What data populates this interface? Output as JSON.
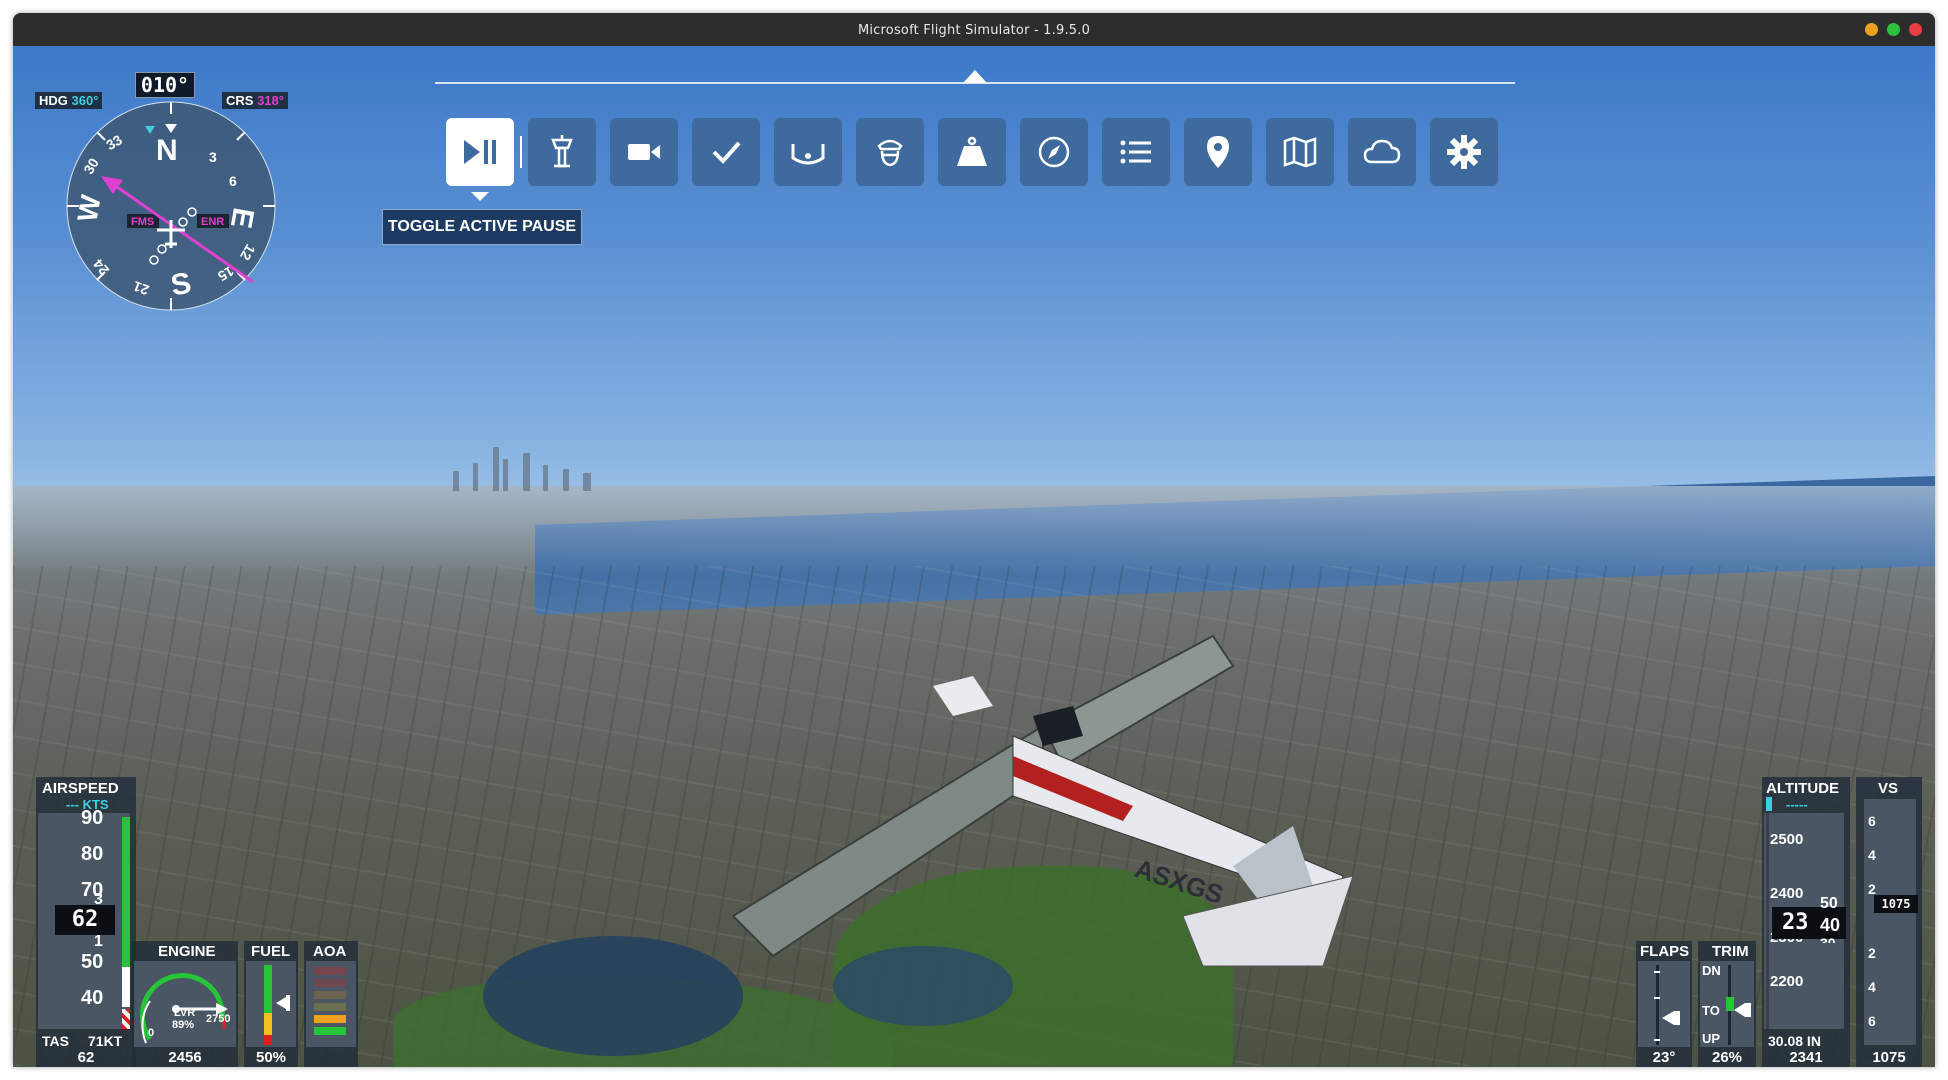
{
  "window": {
    "title": "Microsoft Flight Simulator - 1.9.5.0",
    "controls": {
      "minimize_color": "#f0a020",
      "zoom_color": "#30c040",
      "close_color": "#e84040"
    }
  },
  "toolbar": {
    "buttons": [
      {
        "name": "pause",
        "icon": "play-pause-icon",
        "active": true
      },
      {
        "name": "atc",
        "icon": "control-tower-icon"
      },
      {
        "name": "camera",
        "icon": "video-camera-icon"
      },
      {
        "name": "checklist",
        "icon": "checkmark-icon"
      },
      {
        "name": "controls",
        "icon": "yoke-icon"
      },
      {
        "name": "pilot",
        "icon": "pilot-icon"
      },
      {
        "name": "weight",
        "icon": "weight-icon"
      },
      {
        "name": "navlog",
        "icon": "compass-icon"
      },
      {
        "name": "objectives",
        "icon": "list-icon"
      },
      {
        "name": "waypoints",
        "icon": "map-pin-icon"
      },
      {
        "name": "vfr-map",
        "icon": "map-icon"
      },
      {
        "name": "weather",
        "icon": "cloud-icon"
      },
      {
        "name": "settings",
        "icon": "gear-icon"
      }
    ],
    "tooltip": "TOGGLE ACTIVE PAUSE"
  },
  "compass": {
    "hdg_label": "HDG",
    "hdg_value": "360°",
    "crs_label": "CRS",
    "crs_value": "318°",
    "heading_readout": "010°",
    "cardinals": {
      "n": "N",
      "e": "E",
      "s": "S",
      "w": "W"
    },
    "numbers": [
      "3",
      "6",
      "12",
      "15",
      "21",
      "24",
      "30",
      "33"
    ],
    "fms": "FMS",
    "enr": "ENR"
  },
  "airspeed": {
    "label": "AIRSPEED",
    "unit": "--- KTS",
    "ticks": [
      "90",
      "80",
      "70",
      "50",
      "40"
    ],
    "readout_main": "62",
    "readout_roll_top": "3",
    "readout_roll_bottom": "1",
    "tas_label": "TAS",
    "tas_value": "71KT",
    "bottom_value": "62"
  },
  "engine": {
    "label": "ENGINE",
    "lvr_label": "LVR",
    "lvr_value": "89%",
    "zero": "0",
    "max": "2750",
    "bottom_value": "2456"
  },
  "fuel": {
    "label": "FUEL",
    "bottom_value": "50%"
  },
  "aoa": {
    "label": "AOA"
  },
  "flaps": {
    "label": "FLAPS",
    "bottom_value": "23°"
  },
  "trim": {
    "label": "TRIM",
    "dn": "DN",
    "to": "TO",
    "up": "UP",
    "bottom_value": "26%"
  },
  "altitude": {
    "label": "ALTITUDE",
    "selected": "-----",
    "ticks": [
      "2500",
      "2400",
      "2300",
      "2200"
    ],
    "readout_main": "23",
    "readout_roll_top": "50",
    "readout_roll_mid": "40",
    "readout_roll_bottom": "30",
    "baro": "30.08 IN",
    "bottom_value": "2341"
  },
  "vs": {
    "label": "VS",
    "ticks": [
      "6",
      "4",
      "2",
      "2",
      "4",
      "6"
    ],
    "readout": "1075",
    "bottom_value": "1075"
  },
  "aircraft": {
    "registration": "ASXGS"
  }
}
